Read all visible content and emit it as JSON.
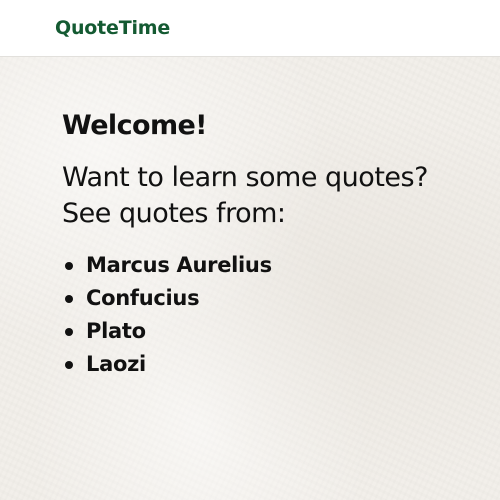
{
  "navbar": {
    "brand": "QuoteTime",
    "brand_color": "#145a32"
  },
  "main": {
    "heading": "Welcome!",
    "intro_line1": "Want to learn some quotes?",
    "intro_line2": "See quotes from:",
    "authors": [
      {
        "label": "Marcus Aurelius"
      },
      {
        "label": "Confucius"
      },
      {
        "label": "Plato"
      },
      {
        "label": "Laozi"
      }
    ]
  }
}
